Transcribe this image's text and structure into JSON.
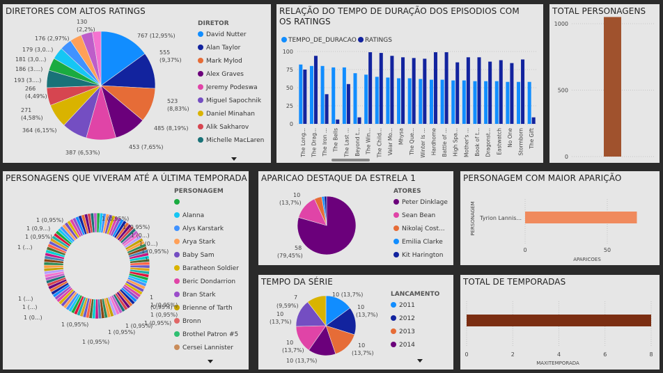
{
  "colors": {
    "card": "#e6e6e6",
    "dark": "#2b2b2b"
  },
  "scroll_icon": "caret-down-icon",
  "directors": {
    "title": "DIRETORES COM ALTOS RATINGS",
    "legend_title": "DIRETOR",
    "legend": [
      "David Nutter",
      "Alan Taylor",
      "Mark Mylod",
      "Alex Graves",
      "Jeremy Podeswa",
      "Miguel Sapochnik",
      "Daniel Minahan",
      "Alik Sakharov",
      "Michelle MacLaren"
    ],
    "slice_labels": [
      "767 (12,95%)",
      "555 (9,37%)",
      "523 (8,83%)",
      "485 (8,19%)",
      "453 (7,65%)",
      "387 (6,53%)",
      "364 (6,15%)",
      "271 (4,58%)",
      "266 (4,49%)",
      "193 (3....)",
      "186 (3....)",
      "181 (3,0...)",
      "179 (3,0...)",
      "176 (2,97%)",
      "130 (2,2%)"
    ]
  },
  "episodes": {
    "title": "RELAÇÃO DO TEMPO DE DURAÇÃO DOS EPISODIOS COM OS RATINGS",
    "series_names": [
      "TEMPO_DE_DURACAO",
      "RATINGS"
    ],
    "yticks": [
      "100",
      "75",
      "50",
      "25",
      "0"
    ],
    "categories": [
      "The Long...",
      "The Drag...",
      "The Iron ...",
      "The Bells",
      "The Last ...",
      "Beyond t...",
      "The Win...",
      "The Child...",
      "Valar Mo...",
      "Mhysa",
      "The Que...",
      "Winter Is ...",
      "Hardhome",
      "Battle of ...",
      "High Spa...",
      "Mother's ...",
      "Book of t...",
      "Dragonst...",
      "Eastwatch",
      "No One",
      "Stormborn",
      "The Gift"
    ]
  },
  "total_personagens": {
    "title": "TOTAL PERSONAGENS",
    "yticks": [
      "1000",
      "500",
      "0"
    ]
  },
  "survivors": {
    "title": "PERSONAGENS QUE VIVERAM ATÉ A ÚLTIMA TEMPORADA",
    "legend_title": "PERSONAGEM",
    "legend": [
      "",
      "Alanna",
      "Alys Karstark",
      "Arya Stark",
      "Baby Sam",
      "Baratheon Soldier",
      "Beric Dondarrion",
      "Bran Stark",
      "Brienne of Tarth",
      "Bronn",
      "Brothel Patron #5",
      "Cersei Lannister"
    ],
    "slice_labels": [
      "1 (0,95%)",
      "1 (0,95%)",
      "1 (0...)",
      "1 (0...)",
      "1 (0,95%)",
      "1 (0,95%)",
      "1 (0,95%)",
      "1 (0...)",
      "1 (0...)",
      "1 (0,95%)",
      "1 (0,95%)",
      "1 (0,95%)",
      "1 (0,95%)",
      "1 (0,95%)",
      "1 (0...)",
      "1 (...)",
      "1 (...)",
      "1 (...)",
      "1 (0,95%)",
      "1 (0,9...)",
      "1 (0,95%)"
    ]
  },
  "aparicao": {
    "title": "APARICAO DESTAQUE DA ESTRELA 1",
    "legend_title": "ATORES",
    "legend": [
      "Peter Dinklage",
      "Sean Bean",
      "Nikolaj Cost...",
      "Emilia Clarke",
      "Kit Harington"
    ],
    "slice_labels": [
      "10 (13,7%)",
      "58 (79,45%)"
    ]
  },
  "maior_aparicao": {
    "title": "PERSONAGEM COM MAIOR APARIÇÃO",
    "ylabel": "PERSONAGEM",
    "xlabel": "APARICOES",
    "category": "Tyrion Lannis...",
    "xticks": [
      "0",
      "50"
    ]
  },
  "tempo_serie": {
    "title": "TEMPO DA SÉRIE",
    "legend_title": "LANCAMENTO",
    "legend": [
      "2011",
      "2012",
      "2013",
      "2014"
    ],
    "slice_labels": [
      "10 (13,7%)",
      "10 (13,7%)",
      "10 (13,7%)",
      "10 (13,7%)",
      "10 (13,7%)",
      "10 (13,7%)",
      "7 (9,59%)"
    ]
  },
  "temporadas": {
    "title": "TOTAL DE TEMPORADAS",
    "xlabel": "MAXITEMPORADA",
    "xticks": [
      "0",
      "2",
      "4",
      "6",
      "8"
    ]
  },
  "chart_data": [
    {
      "type": "pie",
      "title": "DIRETORES COM ALTOS RATINGS",
      "categories": [
        "David Nutter",
        "Alan Taylor",
        "Mark Mylod",
        "Alex Graves",
        "Jeremy Podeswa",
        "Miguel Sapochnik",
        "Daniel Minahan",
        "Alik Sakharov",
        "Michelle MacLaren",
        "",
        "",
        "",
        "",
        "",
        ""
      ],
      "values": [
        767,
        555,
        523,
        485,
        453,
        387,
        364,
        271,
        266,
        193,
        186,
        181,
        179,
        176,
        130
      ],
      "colors": [
        "#118DFF",
        "#12239E",
        "#E66C37",
        "#6B007B",
        "#E044A7",
        "#744EC2",
        "#D9B300",
        "#D64550",
        "#197278",
        "#1AAB40",
        "#15C6F4",
        "#4092FF",
        "#FFA058",
        "#BE5DC9",
        "#F472D0"
      ]
    },
    {
      "type": "bar",
      "title": "RELAÇÃO DO TEMPO DE DURAÇÃO DOS EPISODIOS COM OS RATINGS",
      "categories": [
        "The Long...",
        "The Drag...",
        "The Iron ...",
        "The Bells",
        "The Last ...",
        "Beyond t...",
        "The Win...",
        "The Child...",
        "Valar Mo...",
        "Mhysa",
        "The Que...",
        "Winter Is ...",
        "Hardhome",
        "Battle of ...",
        "High Spa...",
        "Mother's ...",
        "Book of t...",
        "Dragonst...",
        "Eastwatch",
        "No One",
        "Stormborn",
        "The Gift"
      ],
      "series": [
        {
          "name": "TEMPO_DE_DURACAO",
          "color": "#118DFF",
          "values": [
            82,
            80,
            80,
            78,
            78,
            70,
            68,
            65,
            64,
            63,
            63,
            62,
            61,
            61,
            60,
            60,
            59,
            59,
            59,
            58,
            58,
            58
          ]
        },
        {
          "name": "RATINGS",
          "color": "#12239E",
          "values": [
            75,
            94,
            41,
            6,
            55,
            9,
            99,
            98,
            94,
            92,
            91,
            90,
            99,
            99,
            85,
            92,
            92,
            86,
            88,
            84,
            89,
            9
          ]
        }
      ],
      "ylim": [
        0,
        100
      ]
    },
    {
      "type": "bar",
      "title": "TOTAL PERSONAGENS",
      "categories": [
        ""
      ],
      "values": [
        1050
      ],
      "ylim": [
        0,
        1000
      ],
      "color": "#A0522D"
    },
    {
      "type": "pie",
      "title": "PERSONAGENS QUE VIVERAM ATÉ A ÚLTIMA TEMPORADA",
      "donut": true,
      "categories": [
        "",
        "Alanna",
        "Alys Karstark",
        "Arya Stark",
        "Baby Sam",
        "Baratheon Soldier",
        "Beric Dondarrion",
        "Bran Stark",
        "Brienne of Tarth",
        "Bronn",
        "Brothel Patron #5",
        "Cersei Lannister"
      ],
      "slice_count": 105,
      "slice_value": 1
    },
    {
      "type": "pie",
      "title": "APARICAO DESTAQUE DA ESTRELA 1",
      "categories": [
        "Peter Dinklage",
        "Sean Bean",
        "Nikolaj Cost...",
        "Emilia Clarke",
        "Kit Harington"
      ],
      "values": [
        58,
        10,
        3,
        1,
        1
      ],
      "colors": [
        "#6B007B",
        "#E044A7",
        "#E66C37",
        "#118DFF",
        "#12239E"
      ]
    },
    {
      "type": "bar",
      "orientation": "horizontal",
      "title": "PERSONAGEM COM MAIOR APARIÇÃO",
      "categories": [
        "Tyrion Lannis..."
      ],
      "values": [
        68
      ],
      "xlabel": "APARICOES",
      "ylabel": "PERSONAGEM",
      "color": "#F08A5D"
    },
    {
      "type": "pie",
      "title": "TEMPO DA SÉRIE",
      "categories": [
        "2011",
        "2012",
        "2013",
        "2014",
        "",
        "",
        ""
      ],
      "values": [
        10,
        10,
        10,
        10,
        10,
        10,
        7
      ],
      "colors": [
        "#118DFF",
        "#12239E",
        "#E66C37",
        "#6B007B",
        "#E044A7",
        "#744EC2",
        "#D9B300"
      ]
    },
    {
      "type": "bar",
      "orientation": "horizontal",
      "title": "TOTAL DE TEMPORADAS",
      "categories": [
        ""
      ],
      "values": [
        8
      ],
      "xlabel": "MAXITEMPORADA",
      "xlim": [
        0,
        8
      ],
      "color": "#7B2E12"
    }
  ]
}
